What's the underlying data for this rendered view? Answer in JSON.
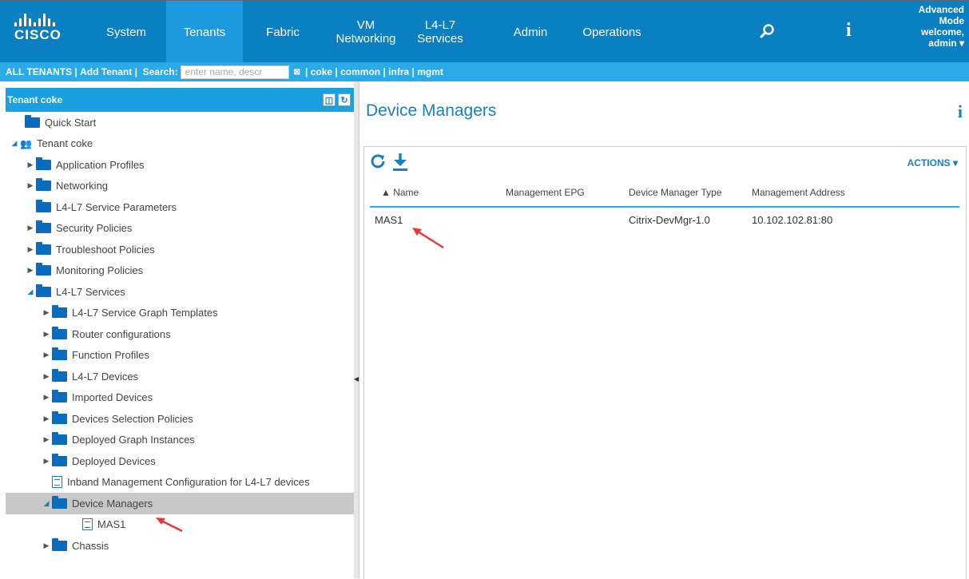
{
  "nav": {
    "items": [
      "System",
      "Tenants",
      "Fabric",
      "VM\nNetworking",
      "L4-L7\nServices",
      "Admin",
      "Operations"
    ],
    "logo_text": "CISCO",
    "mode_lines": [
      "Advanced",
      "Mode",
      "welcome,",
      "admin ▾"
    ]
  },
  "subnav": {
    "all_tenants": "ALL TENANTS",
    "add_tenant": "Add Tenant",
    "search_label": "Search:",
    "search_placeholder": "enter name, descr",
    "tenant_links": [
      "coke",
      "common",
      "infra",
      "mgmt"
    ]
  },
  "left": {
    "header": "Tenant coke",
    "tree": [
      {
        "label": "Quick Start",
        "level": 0,
        "icon": "folder",
        "tri": "none"
      },
      {
        "label": "Tenant coke",
        "level": 0,
        "icon": "people",
        "tri": "open"
      },
      {
        "label": "Application Profiles",
        "level": 1,
        "icon": "folder",
        "tri": "closed"
      },
      {
        "label": "Networking",
        "level": 1,
        "icon": "folder",
        "tri": "closed"
      },
      {
        "label": "L4-L7 Service Parameters",
        "level": 1,
        "icon": "folder",
        "tri": "none"
      },
      {
        "label": "Security Policies",
        "level": 1,
        "icon": "folder",
        "tri": "closed"
      },
      {
        "label": "Troubleshoot Policies",
        "level": 1,
        "icon": "folder",
        "tri": "closed"
      },
      {
        "label": "Monitoring Policies",
        "level": 1,
        "icon": "folder",
        "tri": "closed"
      },
      {
        "label": "L4-L7 Services",
        "level": 1,
        "icon": "folder",
        "tri": "open"
      },
      {
        "label": "L4-L7 Service Graph Templates",
        "level": 2,
        "icon": "folder",
        "tri": "closed"
      },
      {
        "label": "Router configurations",
        "level": 2,
        "icon": "folder",
        "tri": "closed"
      },
      {
        "label": "Function Profiles",
        "level": 2,
        "icon": "folder",
        "tri": "closed"
      },
      {
        "label": "L4-L7 Devices",
        "level": 2,
        "icon": "folder",
        "tri": "closed"
      },
      {
        "label": "Imported Devices",
        "level": 2,
        "icon": "folder",
        "tri": "closed"
      },
      {
        "label": "Devices Selection Policies",
        "level": 2,
        "icon": "folder",
        "tri": "closed"
      },
      {
        "label": "Deployed Graph Instances",
        "level": 2,
        "icon": "folder",
        "tri": "closed"
      },
      {
        "label": "Deployed Devices",
        "level": 2,
        "icon": "folder",
        "tri": "closed"
      },
      {
        "label": "Inband Management Configuration for L4-L7 devices",
        "level": 2,
        "icon": "doc",
        "tri": "none"
      },
      {
        "label": "Device Managers",
        "level": 2,
        "icon": "folder",
        "tri": "open",
        "selected": true
      },
      {
        "label": "MAS1",
        "level": 3,
        "icon": "doc",
        "tri": "none"
      },
      {
        "label": "Chassis",
        "level": 2,
        "icon": "folder",
        "tri": "closed"
      }
    ]
  },
  "main": {
    "title": "Device Managers",
    "actions_label": "ACTIONS ▾",
    "columns": [
      "▲ Name",
      "Management EPG",
      "Device Manager Type",
      "Management Address"
    ],
    "rows": [
      [
        "MAS1",
        "",
        "Citrix-DevMgr-1.0",
        "10.102.102.81:80"
      ]
    ]
  },
  "colors": {
    "nav_bg": "#0a7fc2",
    "active_tab": "#1c9ae0",
    "subnav_bg": "#2aaae6",
    "accent": "#1a7fc2",
    "annotation_arrow": "#e53935"
  }
}
